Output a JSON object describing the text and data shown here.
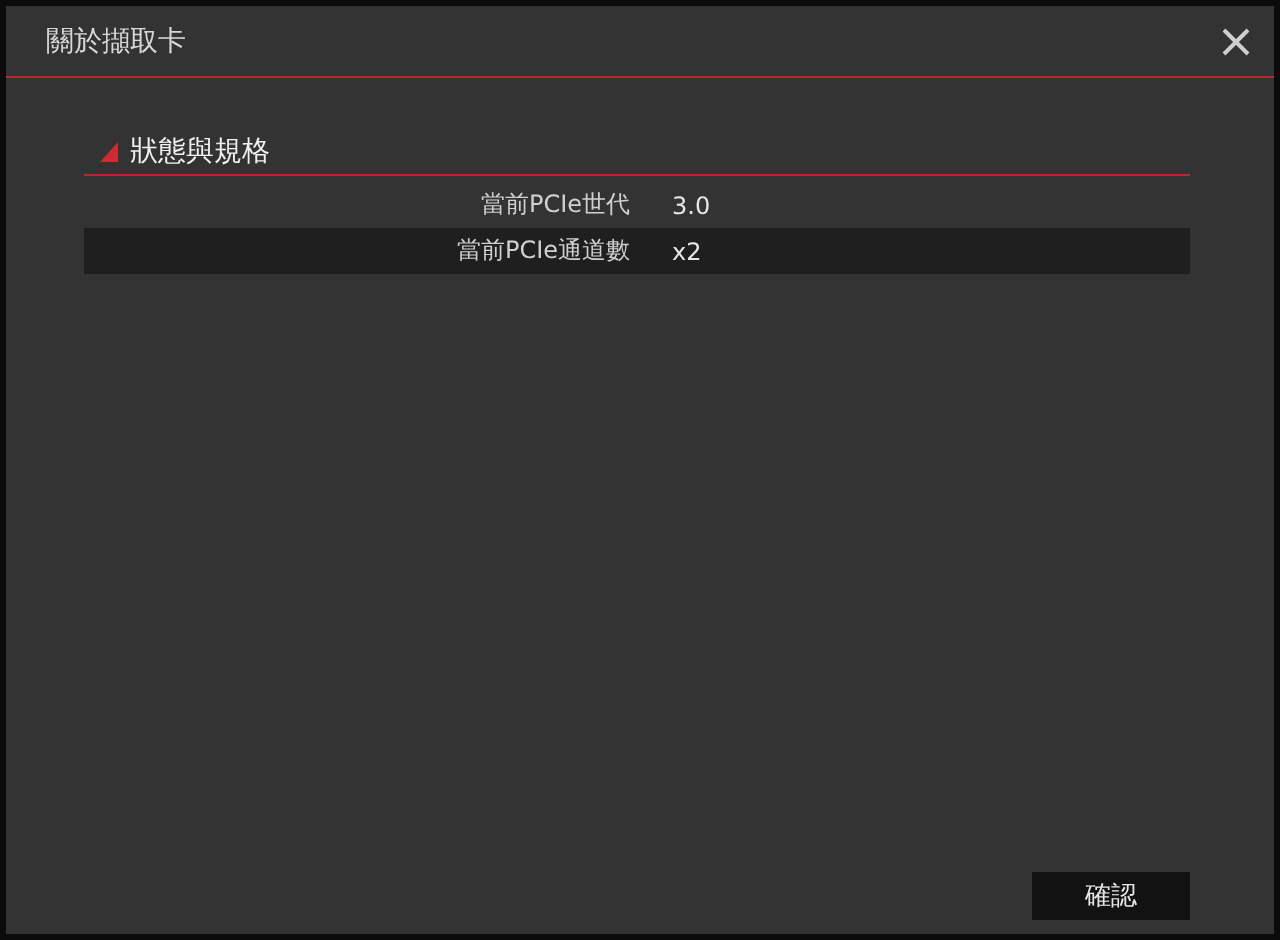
{
  "window": {
    "title": "關於擷取卡"
  },
  "section": {
    "title": "狀態與規格"
  },
  "rows": [
    {
      "label": "當前PCIe世代",
      "value": "3.0"
    },
    {
      "label": "當前PCIe通道數",
      "value": "x2"
    }
  ],
  "buttons": [
    "確認"
  ]
}
